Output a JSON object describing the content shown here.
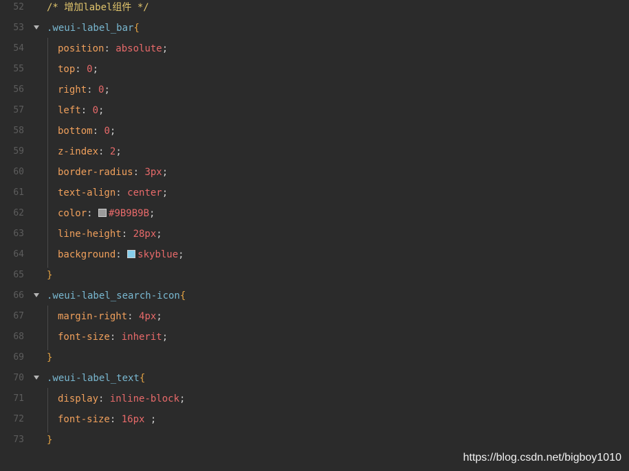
{
  "colors": {
    "background": "#2b2b2b",
    "line_number": "#5d5d5d",
    "comment": "#e0c46c",
    "selector": "#79b8d1",
    "brace": "#e5a343",
    "property": "#f0a05c",
    "value": "#e86a6a",
    "swatch_gray": "#9B9B9B",
    "swatch_skyblue": "skyblue"
  },
  "code_lines": [
    {
      "num": "52",
      "comment": "/* 增加label组件 */"
    },
    {
      "num": "53",
      "selector": ".weui-label_bar",
      "brace": "{",
      "foldable": true
    },
    {
      "num": "54",
      "prop": "position",
      "value": "absolute"
    },
    {
      "num": "55",
      "prop": "top",
      "value": "0"
    },
    {
      "num": "56",
      "prop": "right",
      "value": "0"
    },
    {
      "num": "57",
      "prop": "left",
      "value": "0"
    },
    {
      "num": "58",
      "prop": "bottom",
      "value": "0"
    },
    {
      "num": "59",
      "prop": "z-index",
      "value": "2"
    },
    {
      "num": "60",
      "prop": "border-radius",
      "value": "3px"
    },
    {
      "num": "61",
      "prop": "text-align",
      "value": "center"
    },
    {
      "num": "62",
      "prop": "color",
      "value": "#9B9B9B",
      "swatch": "#9B9B9B"
    },
    {
      "num": "63",
      "prop": "line-height",
      "value": "28px"
    },
    {
      "num": "64",
      "prop": "background",
      "value": "skyblue",
      "swatch": "skyblue"
    },
    {
      "num": "65",
      "close": "}"
    },
    {
      "num": "66",
      "selector": ".weui-label_search-icon",
      "brace": "{",
      "foldable": true
    },
    {
      "num": "67",
      "prop": "margin-right",
      "value": "4px"
    },
    {
      "num": "68",
      "prop": "font-size",
      "value": "inherit"
    },
    {
      "num": "69",
      "close": "}"
    },
    {
      "num": "70",
      "selector": ".weui-label_text",
      "brace": "{",
      "foldable": true
    },
    {
      "num": "71",
      "prop": "display",
      "value": "inline-block"
    },
    {
      "num": "72",
      "prop": "font-size",
      "value": "16px ",
      "semicolon_suffix": ";"
    },
    {
      "num": "73",
      "close": "}"
    }
  ],
  "watermark": "https://blog.csdn.net/bigboy1010"
}
